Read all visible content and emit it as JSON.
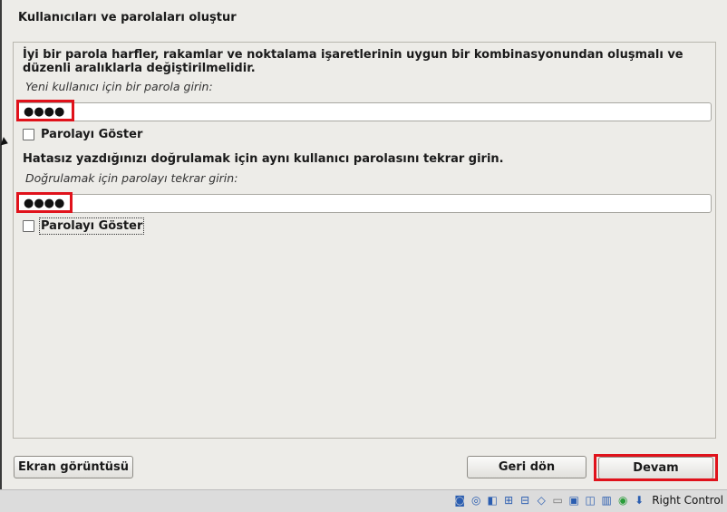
{
  "window": {
    "title": "Kullanıcıları ve parolaları oluştur"
  },
  "password": {
    "instruction": "İyi bir parola harfler, rakamlar ve noktalama işaretlerinin uygun bir kombinasyonundan oluşmalı ve düzenli aralıklarla değiştirilmelidir.",
    "prompt": "Yeni kullanıcı için bir parola girin:",
    "value": "●●●●",
    "show_label": "Parolayı Göster"
  },
  "verify": {
    "instruction": "Hatasız yazdığınızı doğrulamak için aynı kullanıcı parolasını tekrar girin.",
    "prompt": "Doğrulamak için parolayı tekrar girin:",
    "value": "●●●●",
    "show_label": "Parolayı Göster"
  },
  "buttons": {
    "screenshot": "Ekran görüntüsü",
    "back": "Geri dön",
    "continue": "Devam"
  },
  "statusbar": {
    "host_key": "Right Control",
    "icons": [
      "hdd-icon",
      "cd-icon",
      "audio-icon",
      "network-icon",
      "usb-icon",
      "shared-folder-icon",
      "display-icon",
      "record-icon",
      "vm-icon",
      "virtualization-icon",
      "mouse-integration-icon",
      "arrow-down-icon"
    ]
  },
  "highlight_color": "#e0121b"
}
